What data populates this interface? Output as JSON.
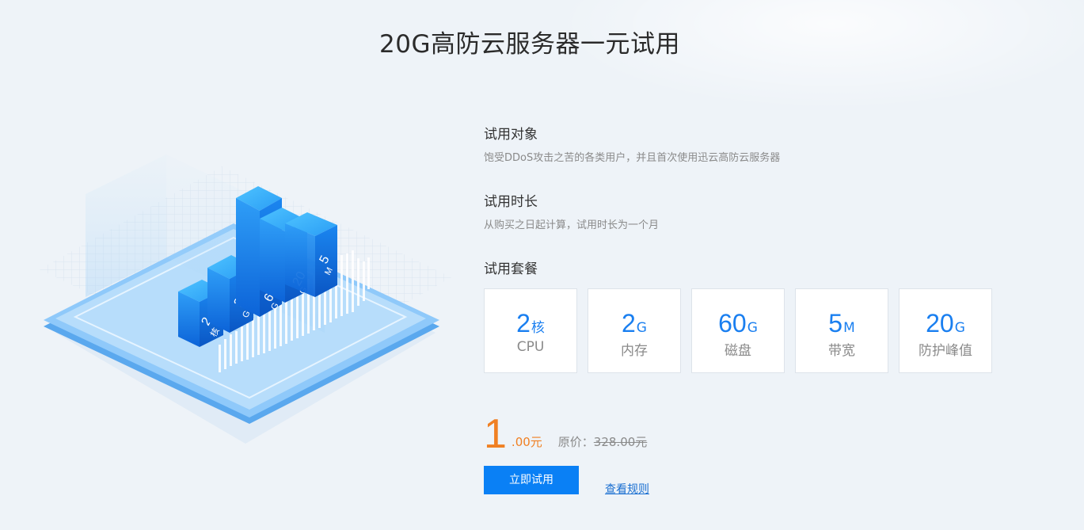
{
  "page": {
    "title": "20G高防云服务器一元试用"
  },
  "hero": {
    "bar_labels": [
      {
        "value": "2",
        "unit": "核"
      },
      {
        "value": "2",
        "unit": "G"
      },
      {
        "value": "60",
        "unit": "G"
      },
      {
        "value": "20",
        "unit": "G"
      },
      {
        "value": "5",
        "unit": "M"
      }
    ]
  },
  "sections": [
    {
      "heading": "试用对象",
      "desc": "饱受DDoS攻击之苦的各类用户，并且首次使用迅云高防云服务器"
    },
    {
      "heading": "试用时长",
      "desc": "从购买之日起计算，试用时长为一个月"
    },
    {
      "heading": "试用套餐"
    }
  ],
  "specs": [
    {
      "value": "2",
      "unit": "核",
      "label": "CPU"
    },
    {
      "value": "2",
      "unit": "G",
      "label": "内存"
    },
    {
      "value": "60",
      "unit": "G",
      "label": "磁盘"
    },
    {
      "value": "5",
      "unit": "M",
      "label": "带宽"
    },
    {
      "value": "20",
      "unit": "G",
      "label": "防护峰值"
    }
  ],
  "price": {
    "integer": "1",
    "decimal": ".00元",
    "original_label": "原价：",
    "original_value": "328.00元"
  },
  "actions": {
    "try_label": "立即试用",
    "rules_label": "查看规则"
  },
  "colors": {
    "accent": "#0a80f5",
    "price": "#f08023",
    "spec_value": "#1a7ff0",
    "background": "#eef3f8"
  }
}
